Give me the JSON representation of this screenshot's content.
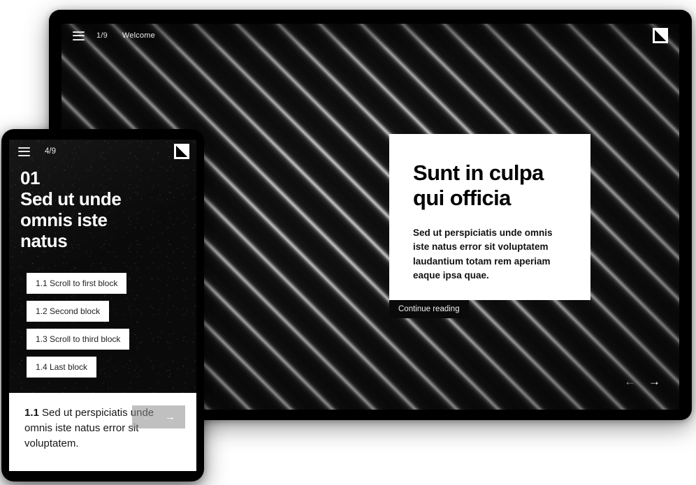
{
  "desktop": {
    "topbar": {
      "menu_icon": "hamburger-menu-icon",
      "counter": "1/9",
      "title": "Welcome",
      "logo_icon": "triangle-square-logo-icon"
    },
    "card": {
      "title": "Sunt in culpa\nqui officia",
      "body": "Sed ut perspiciatis unde omnis iste natus error sit voluptatem laudantium totam rem aperiam eaque ipsa quae."
    },
    "continue_button": "Continue reading",
    "nav": {
      "prev_icon": "arrow-left-icon",
      "prev_label": "←",
      "prev_disabled": true,
      "next_icon": "arrow-right-icon",
      "next_label": "→",
      "next_disabled": false
    }
  },
  "phone": {
    "topbar": {
      "menu_icon": "hamburger-menu-icon",
      "counter": "4/9",
      "logo_icon": "triangle-square-logo-icon"
    },
    "heading": "01\nSed ut unde\nomnis iste\nnatus",
    "list": [
      {
        "label": "1.1 Scroll to first block"
      },
      {
        "label": "1.2 Second block"
      },
      {
        "label": "1.3 Scroll to third block"
      },
      {
        "label": "1.4 Last block"
      }
    ],
    "bottom_panel": {
      "marker": "1.1",
      "text": " Sed ut perspiciatis unde omnis iste natus error sit voluptatem."
    },
    "nav": {
      "prev_label": "←",
      "prev_disabled": true,
      "next_label": "→",
      "next_disabled": false
    }
  },
  "colors": {
    "background": "#ffffff",
    "device_bezel": "#000000",
    "card_background": "#ffffff",
    "text_dark": "#000000",
    "text_light": "#ffffff",
    "button_dark": "#0a0a0a"
  }
}
